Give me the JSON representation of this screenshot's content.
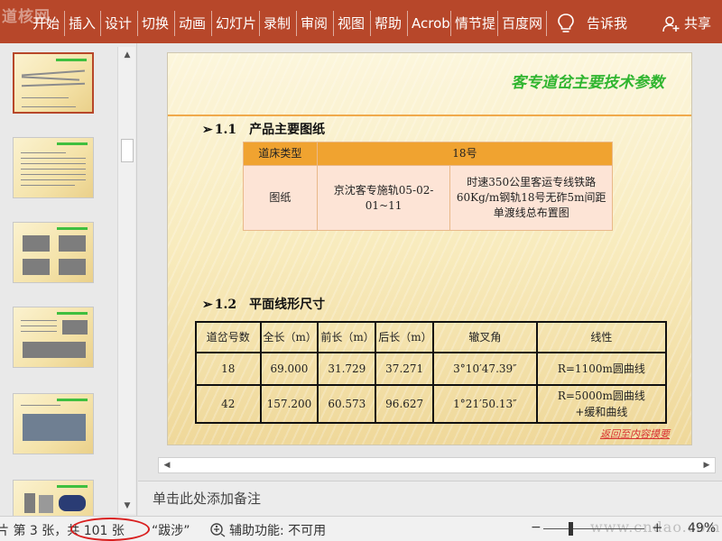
{
  "ribbon": {
    "watermark": "道核网",
    "tabs": [
      "开始",
      "插入",
      "设计",
      "切换",
      "动画",
      "幻灯片",
      "录制",
      "审阅",
      "视图",
      "帮助",
      "Acrobat",
      "情节提",
      "百度网"
    ],
    "tell_me": "告诉我",
    "share": "共享",
    "accent_color": "#b7472a"
  },
  "slide": {
    "title": "客专道岔主要技术参数",
    "section1": {
      "arrow": "➢",
      "heading": "1.1　产品主要图纸",
      "table": {
        "header": [
          "道床类型",
          "18号"
        ],
        "row_label": "图纸",
        "cell_a": "京沈客专施轨05-02-01~11",
        "cell_b": "时速350公里客运专线铁路60Kg/m钢轨18号无砟5m间距单渡线总布置图"
      }
    },
    "section2": {
      "arrow": "➢",
      "heading": "1.2　平面线形尺寸",
      "table": {
        "columns": [
          "道岔号数",
          "全长（m）",
          "前长（m）",
          "后长（m）",
          "辙叉角",
          "线性"
        ],
        "rows": [
          [
            "18",
            "69.000",
            "31.729",
            "37.271",
            "3°10′47.39″",
            "R=1100m圆曲线"
          ],
          [
            "42",
            "157.200",
            "60.573",
            "96.627",
            "1°21′50.13″",
            "R=5000m圆曲线\n+缓和曲线"
          ]
        ]
      }
    },
    "back_link": "返回至内容摸要"
  },
  "notes": {
    "placeholder": "单击此处添加备注"
  },
  "status": {
    "slide_count": "片 第 3 张，共 101 张",
    "theme": "“跋涉”",
    "accessibility": "辅助功能: 不可用",
    "zoom_minus": "−",
    "zoom_plus": "+",
    "zoom_level": "49%",
    "watermark_url": "www.cndao.com"
  }
}
